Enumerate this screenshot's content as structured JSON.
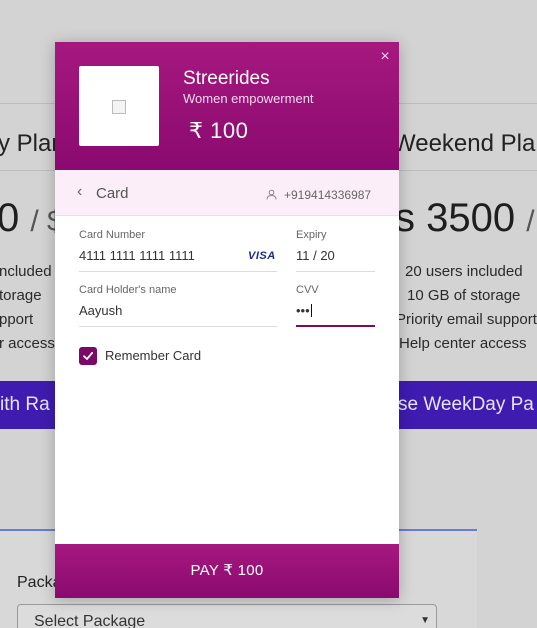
{
  "background": {
    "plans": [
      {
        "title": "y Plan",
        "price": "0",
        "per": "/ $",
        "features": [
          "ncluded",
          "torage",
          "pport",
          "r access"
        ],
        "cta": "ith Ra"
      },
      {
        "title": "Weekend Plan",
        "price": "s 3500",
        "per": "/ s",
        "features": [
          "20 users included",
          "10 GB of storage",
          "Priority email support",
          "Help center access"
        ],
        "cta": "se WeekDay Pa"
      }
    ],
    "package_label": "Packa",
    "package_select": "Select Package"
  },
  "checkout": {
    "merchant_name": "Streerides",
    "merchant_tagline": "Women empowerment",
    "amount": "₹ 100",
    "close_symbol": "×",
    "method": "Card",
    "phone": "+919414336987",
    "fields": {
      "card_number_label": "Card Number",
      "card_number_value": "4111 1111 1111 1111",
      "card_network": "VISA",
      "expiry_label": "Expiry",
      "expiry_value": "11 / 20",
      "holder_label": "Card Holder's name",
      "holder_value": "Aayush",
      "cvv_label": "CVV",
      "cvv_value": "•••"
    },
    "remember_label": "Remember Card",
    "remember_checked": true,
    "pay_label": "PAY ₹ 100",
    "accent_color": "#8a0a6f",
    "icons": [
      "close-icon",
      "chevron-left-icon",
      "user-icon",
      "visa-logo",
      "check-icon"
    ]
  }
}
